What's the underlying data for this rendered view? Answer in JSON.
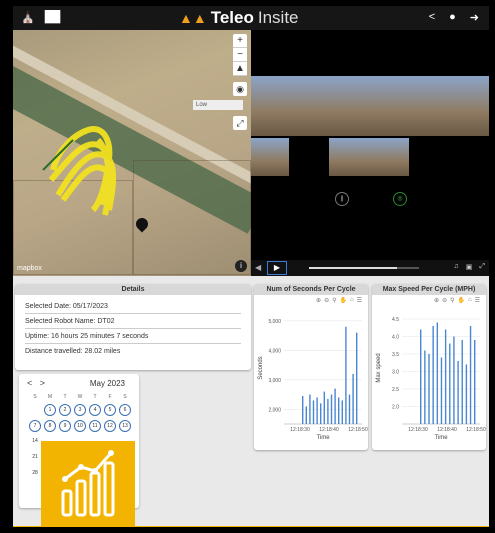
{
  "header": {
    "brand_bold": "Teleo",
    "brand_light": "Insite"
  },
  "map": {
    "layer_label": "Low",
    "attribution": "mapbox"
  },
  "video": {
    "ctrl1": "||",
    "ctrl2": "◎"
  },
  "details": {
    "title": "Details",
    "rows": [
      "Selected Date: 05/17/2023",
      "Selected Robot Name: DT02",
      "Uptime: 16 hours 25 minutes 7 seconds",
      "Distance travelled: 28.02 miles"
    ]
  },
  "calendar": {
    "month": "May 2023",
    "weekdays": [
      "S",
      "M",
      "T",
      "W",
      "T",
      "F",
      "S"
    ],
    "week1": [
      "1",
      "2",
      "3",
      "4",
      "5",
      "6"
    ],
    "week2": [
      "7",
      "8",
      "9",
      "10",
      "11",
      "12",
      "13"
    ],
    "week3": [
      "14"
    ],
    "week4": [
      "21"
    ],
    "week5": [
      "28"
    ]
  },
  "chart_data": [
    {
      "type": "bar",
      "title": "Num of Seconds Per Cycle",
      "xlabel": "Time",
      "ylabel": "Seconds",
      "yticks": [
        "5,000",
        "4,000",
        "3,000",
        "2,000"
      ],
      "xticks": [
        "12:18:30",
        "12:18:40",
        "12:18:50"
      ],
      "ylim": [
        1500,
        5300
      ],
      "values": [
        2450,
        2100,
        2500,
        2300,
        2400,
        2200,
        2600,
        2350,
        2500,
        2700,
        2400,
        2300,
        4800,
        2500,
        3200,
        4600
      ]
    },
    {
      "type": "bar",
      "title": "Max Speed Per Cycle (MPH)",
      "xlabel": "Time",
      "ylabel": "Max speed",
      "yticks": [
        "4.5",
        "4.0",
        "3.5",
        "3.0",
        "2.5",
        "2.0"
      ],
      "xticks": [
        "12:18:30",
        "12:18:40",
        "12:18:50"
      ],
      "ylim": [
        1.5,
        4.7
      ],
      "values": [
        4.2,
        3.6,
        3.5,
        4.3,
        4.4,
        3.4,
        4.2,
        3.8,
        4.0,
        3.3,
        3.9,
        3.2,
        4.3,
        3.9
      ]
    }
  ]
}
